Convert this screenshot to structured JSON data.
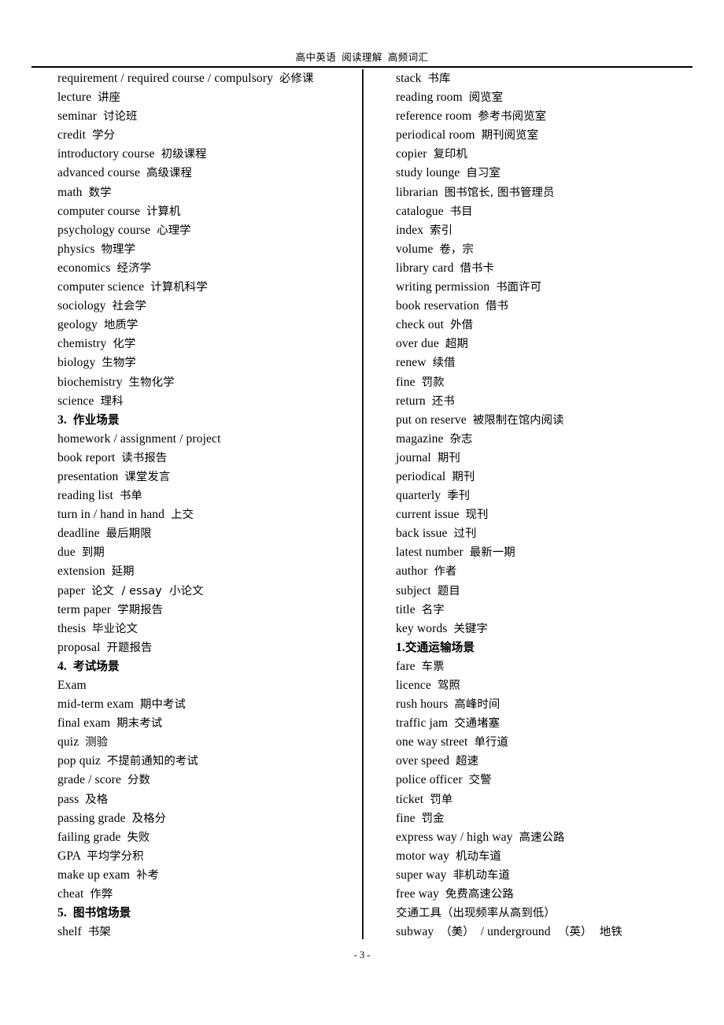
{
  "document": {
    "header_title": "高中英语  阅读理解  高频词汇",
    "page_number": "- 3 -"
  },
  "columns": {
    "left": [
      {
        "en": "requirement / required course / compulsory",
        "cn": "必修课",
        "heading": false
      },
      {
        "en": "lecture",
        "cn": "讲座",
        "heading": false
      },
      {
        "en": "seminar",
        "cn": "讨论班",
        "heading": false
      },
      {
        "en": "credit",
        "cn": "学分",
        "heading": false
      },
      {
        "en": "introductory course",
        "cn": "初级课程",
        "heading": false
      },
      {
        "en": "advanced course",
        "cn": "高级课程",
        "heading": false
      },
      {
        "en": "math",
        "cn": "数学",
        "heading": false
      },
      {
        "en": "computer course",
        "cn": "计算机",
        "heading": false
      },
      {
        "en": "psychology course",
        "cn": "心理学",
        "heading": false
      },
      {
        "en": "physics",
        "cn": "物理学",
        "heading": false
      },
      {
        "en": "economics",
        "cn": "经济学",
        "heading": false
      },
      {
        "en": "computer science",
        "cn": "计算机科学",
        "heading": false
      },
      {
        "en": "sociology",
        "cn": "社会学",
        "heading": false
      },
      {
        "en": "geology",
        "cn": "地质学",
        "heading": false
      },
      {
        "en": "chemistry",
        "cn": "化学",
        "heading": false
      },
      {
        "en": "biology",
        "cn": "生物学",
        "heading": false
      },
      {
        "en": "biochemistry",
        "cn": "生物化学",
        "heading": false
      },
      {
        "en": "science",
        "cn": "理科",
        "heading": false
      },
      {
        "en": "3.",
        "cn": "作业场景",
        "heading": true
      },
      {
        "en": "homework / assignment / project",
        "cn": "",
        "heading": false
      },
      {
        "en": "book report",
        "cn": "读书报告",
        "heading": false
      },
      {
        "en": "presentation",
        "cn": "课堂发言",
        "heading": false
      },
      {
        "en": "reading list",
        "cn": "书单",
        "heading": false
      },
      {
        "en": "turn in / hand in hand",
        "cn": "上交",
        "heading": false
      },
      {
        "en": "deadline",
        "cn": "最后期限",
        "heading": false
      },
      {
        "en": "due",
        "cn": "到期",
        "heading": false
      },
      {
        "en": "extension",
        "cn": "延期",
        "heading": false
      },
      {
        "en": "paper",
        "cn": "论文  / essay  小论文",
        "heading": false
      },
      {
        "en": "term paper",
        "cn": "学期报告",
        "heading": false
      },
      {
        "en": "thesis",
        "cn": "毕业论文",
        "heading": false
      },
      {
        "en": "proposal",
        "cn": "开题报告",
        "heading": false
      },
      {
        "en": "4.",
        "cn": "考试场景",
        "heading": true
      },
      {
        "en": "Exam",
        "cn": "",
        "heading": false
      },
      {
        "en": "mid-term exam",
        "cn": "期中考试",
        "heading": false
      },
      {
        "en": "final exam",
        "cn": "期末考试",
        "heading": false
      },
      {
        "en": "quiz",
        "cn": "测验",
        "heading": false
      },
      {
        "en": "pop quiz",
        "cn": "不提前通知的考试",
        "heading": false
      },
      {
        "en": "grade / score",
        "cn": "分数",
        "heading": false
      },
      {
        "en": "pass",
        "cn": "及格",
        "heading": false
      },
      {
        "en": "passing grade",
        "cn": "及格分",
        "heading": false
      },
      {
        "en": "failing grade",
        "cn": "失败",
        "heading": false
      },
      {
        "en": "GPA",
        "cn": "平均学分积",
        "heading": false
      },
      {
        "en": "make up exam",
        "cn": "补考",
        "heading": false
      },
      {
        "en": "cheat",
        "cn": "作弊",
        "heading": false
      },
      {
        "en": "5.",
        "cn": "图书馆场景",
        "heading": true
      },
      {
        "en": "shelf",
        "cn": "书架",
        "heading": false
      }
    ],
    "right": [
      {
        "en": "stack",
        "cn": "书库",
        "heading": false
      },
      {
        "en": "reading room",
        "cn": "阅览室",
        "heading": false
      },
      {
        "en": "reference room",
        "cn": "参考书阅览室",
        "heading": false
      },
      {
        "en": "periodical room",
        "cn": "期刊阅览室",
        "heading": false
      },
      {
        "en": "copier",
        "cn": "复印机",
        "heading": false
      },
      {
        "en": "study lounge",
        "cn": "自习室",
        "heading": false
      },
      {
        "en": "librarian",
        "cn": "图书馆长, 图书管理员",
        "heading": false
      },
      {
        "en": "catalogue",
        "cn": "书目",
        "heading": false
      },
      {
        "en": "index",
        "cn": "索引",
        "heading": false
      },
      {
        "en": "volume",
        "cn": "卷，宗",
        "heading": false
      },
      {
        "en": "library card",
        "cn": "借书卡",
        "heading": false
      },
      {
        "en": "writing permission",
        "cn": "书面许可",
        "heading": false
      },
      {
        "en": "book reservation",
        "cn": "借书",
        "heading": false
      },
      {
        "en": "check out",
        "cn": "外借",
        "heading": false
      },
      {
        "en": "over due",
        "cn": "超期",
        "heading": false
      },
      {
        "en": "renew",
        "cn": "续借",
        "heading": false
      },
      {
        "en": "fine",
        "cn": "罚款",
        "heading": false
      },
      {
        "en": "return",
        "cn": "还书",
        "heading": false
      },
      {
        "en": "put on reserve",
        "cn": "被限制在馆内阅读",
        "heading": false
      },
      {
        "en": "magazine",
        "cn": "杂志",
        "heading": false
      },
      {
        "en": "journal",
        "cn": "期刊",
        "heading": false
      },
      {
        "en": "periodical",
        "cn": "期刊",
        "heading": false
      },
      {
        "en": "quarterly",
        "cn": "季刊",
        "heading": false
      },
      {
        "en": "current issue",
        "cn": "现刊",
        "heading": false
      },
      {
        "en": "back issue",
        "cn": "过刊",
        "heading": false
      },
      {
        "en": "latest number",
        "cn": "最新一期",
        "heading": false
      },
      {
        "en": "author",
        "cn": "作者",
        "heading": false
      },
      {
        "en": "subject",
        "cn": "题目",
        "heading": false
      },
      {
        "en": "title",
        "cn": "名字",
        "heading": false
      },
      {
        "en": "key words",
        "cn": "关键字",
        "heading": false
      },
      {
        "en": "1.",
        "cn": "交通运输场景",
        "heading": true,
        "tight": true
      },
      {
        "en": "fare",
        "cn": "车票",
        "heading": false
      },
      {
        "en": "licence",
        "cn": "驾照",
        "heading": false
      },
      {
        "en": "rush hours",
        "cn": "高峰时间",
        "heading": false
      },
      {
        "en": "traffic jam",
        "cn": "交通堵塞",
        "heading": false
      },
      {
        "en": "one way street",
        "cn": "单行道",
        "heading": false
      },
      {
        "en": "over speed",
        "cn": "超速",
        "heading": false
      },
      {
        "en": "police officer",
        "cn": "交警",
        "heading": false
      },
      {
        "en": "ticket",
        "cn": "罚单",
        "heading": false
      },
      {
        "en": "fine",
        "cn": "罚金",
        "heading": false
      },
      {
        "en": "express way / high way",
        "cn": "高速公路",
        "heading": false
      },
      {
        "en": "motor way",
        "cn": "机动车道",
        "heading": false
      },
      {
        "en": "super way",
        "cn": "非机动车道",
        "heading": false
      },
      {
        "en": "free way",
        "cn": "免费高速公路",
        "heading": false
      },
      {
        "en": "",
        "cn": "交通工具（出现频率从高到低）",
        "heading": false
      },
      {
        "en": "subway",
        "cn": "（美）",
        "heading": false,
        "tail_en": "/ underground",
        "tail_cn": "（英）  地铁"
      }
    ]
  }
}
